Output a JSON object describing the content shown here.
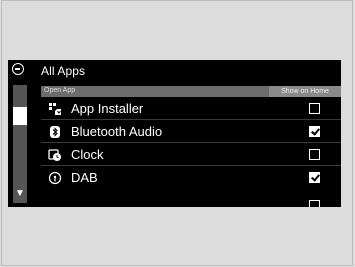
{
  "header": {
    "title": "All Apps",
    "column_left": "Open App",
    "column_right": "Show on Home"
  },
  "colors": {
    "screen_bg": "#000000",
    "page_bg": "#dcdcdc",
    "header_bg": "#6c6c6c",
    "accent_text": "#ffffff"
  },
  "apps": [
    {
      "label": "App Installer",
      "icon": "app-installer-icon",
      "show_on_home": false
    },
    {
      "label": "Bluetooth Audio",
      "icon": "bluetooth-icon",
      "show_on_home": true
    },
    {
      "label": "Clock",
      "icon": "clock-icon",
      "show_on_home": false
    },
    {
      "label": "DAB",
      "icon": "dab-radio-icon",
      "show_on_home": true
    }
  ]
}
